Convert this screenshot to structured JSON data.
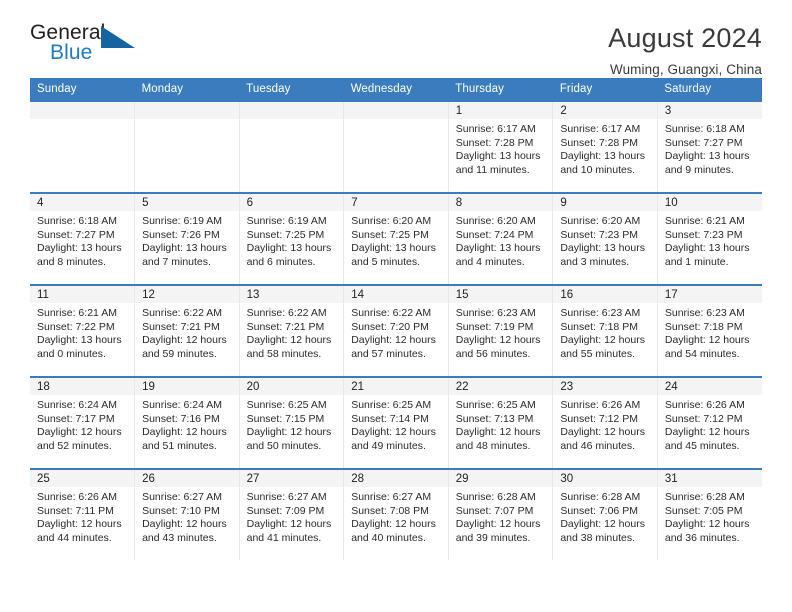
{
  "brand": {
    "word_primary": "General",
    "word_secondary": "Blue",
    "logo_icon": "triangle-logo-icon"
  },
  "header": {
    "title": "August 2024",
    "subtitle": "Wuming, Guangxi, China"
  },
  "colors": {
    "header_blue": "#3a7cbe",
    "brand_blue": "#1f7ac4",
    "logo_blue": "#15639f",
    "daynum_band": "#f4f4f4",
    "text": "#2b2b2b"
  },
  "calendar": {
    "weekday_headers": [
      "Sunday",
      "Monday",
      "Tuesday",
      "Wednesday",
      "Thursday",
      "Friday",
      "Saturday"
    ],
    "weeks": [
      [
        {
          "day": "",
          "sunrise": "",
          "sunset": "",
          "daylight_line1": "",
          "daylight_line2": ""
        },
        {
          "day": "",
          "sunrise": "",
          "sunset": "",
          "daylight_line1": "",
          "daylight_line2": ""
        },
        {
          "day": "",
          "sunrise": "",
          "sunset": "",
          "daylight_line1": "",
          "daylight_line2": ""
        },
        {
          "day": "",
          "sunrise": "",
          "sunset": "",
          "daylight_line1": "",
          "daylight_line2": ""
        },
        {
          "day": "1",
          "sunrise": "Sunrise: 6:17 AM",
          "sunset": "Sunset: 7:28 PM",
          "daylight_line1": "Daylight: 13 hours",
          "daylight_line2": "and 11 minutes."
        },
        {
          "day": "2",
          "sunrise": "Sunrise: 6:17 AM",
          "sunset": "Sunset: 7:28 PM",
          "daylight_line1": "Daylight: 13 hours",
          "daylight_line2": "and 10 minutes."
        },
        {
          "day": "3",
          "sunrise": "Sunrise: 6:18 AM",
          "sunset": "Sunset: 7:27 PM",
          "daylight_line1": "Daylight: 13 hours",
          "daylight_line2": "and 9 minutes."
        }
      ],
      [
        {
          "day": "4",
          "sunrise": "Sunrise: 6:18 AM",
          "sunset": "Sunset: 7:27 PM",
          "daylight_line1": "Daylight: 13 hours",
          "daylight_line2": "and 8 minutes."
        },
        {
          "day": "5",
          "sunrise": "Sunrise: 6:19 AM",
          "sunset": "Sunset: 7:26 PM",
          "daylight_line1": "Daylight: 13 hours",
          "daylight_line2": "and 7 minutes."
        },
        {
          "day": "6",
          "sunrise": "Sunrise: 6:19 AM",
          "sunset": "Sunset: 7:25 PM",
          "daylight_line1": "Daylight: 13 hours",
          "daylight_line2": "and 6 minutes."
        },
        {
          "day": "7",
          "sunrise": "Sunrise: 6:20 AM",
          "sunset": "Sunset: 7:25 PM",
          "daylight_line1": "Daylight: 13 hours",
          "daylight_line2": "and 5 minutes."
        },
        {
          "day": "8",
          "sunrise": "Sunrise: 6:20 AM",
          "sunset": "Sunset: 7:24 PM",
          "daylight_line1": "Daylight: 13 hours",
          "daylight_line2": "and 4 minutes."
        },
        {
          "day": "9",
          "sunrise": "Sunrise: 6:20 AM",
          "sunset": "Sunset: 7:23 PM",
          "daylight_line1": "Daylight: 13 hours",
          "daylight_line2": "and 3 minutes."
        },
        {
          "day": "10",
          "sunrise": "Sunrise: 6:21 AM",
          "sunset": "Sunset: 7:23 PM",
          "daylight_line1": "Daylight: 13 hours",
          "daylight_line2": "and 1 minute."
        }
      ],
      [
        {
          "day": "11",
          "sunrise": "Sunrise: 6:21 AM",
          "sunset": "Sunset: 7:22 PM",
          "daylight_line1": "Daylight: 13 hours",
          "daylight_line2": "and 0 minutes."
        },
        {
          "day": "12",
          "sunrise": "Sunrise: 6:22 AM",
          "sunset": "Sunset: 7:21 PM",
          "daylight_line1": "Daylight: 12 hours",
          "daylight_line2": "and 59 minutes."
        },
        {
          "day": "13",
          "sunrise": "Sunrise: 6:22 AM",
          "sunset": "Sunset: 7:21 PM",
          "daylight_line1": "Daylight: 12 hours",
          "daylight_line2": "and 58 minutes."
        },
        {
          "day": "14",
          "sunrise": "Sunrise: 6:22 AM",
          "sunset": "Sunset: 7:20 PM",
          "daylight_line1": "Daylight: 12 hours",
          "daylight_line2": "and 57 minutes."
        },
        {
          "day": "15",
          "sunrise": "Sunrise: 6:23 AM",
          "sunset": "Sunset: 7:19 PM",
          "daylight_line1": "Daylight: 12 hours",
          "daylight_line2": "and 56 minutes."
        },
        {
          "day": "16",
          "sunrise": "Sunrise: 6:23 AM",
          "sunset": "Sunset: 7:18 PM",
          "daylight_line1": "Daylight: 12 hours",
          "daylight_line2": "and 55 minutes."
        },
        {
          "day": "17",
          "sunrise": "Sunrise: 6:23 AM",
          "sunset": "Sunset: 7:18 PM",
          "daylight_line1": "Daylight: 12 hours",
          "daylight_line2": "and 54 minutes."
        }
      ],
      [
        {
          "day": "18",
          "sunrise": "Sunrise: 6:24 AM",
          "sunset": "Sunset: 7:17 PM",
          "daylight_line1": "Daylight: 12 hours",
          "daylight_line2": "and 52 minutes."
        },
        {
          "day": "19",
          "sunrise": "Sunrise: 6:24 AM",
          "sunset": "Sunset: 7:16 PM",
          "daylight_line1": "Daylight: 12 hours",
          "daylight_line2": "and 51 minutes."
        },
        {
          "day": "20",
          "sunrise": "Sunrise: 6:25 AM",
          "sunset": "Sunset: 7:15 PM",
          "daylight_line1": "Daylight: 12 hours",
          "daylight_line2": "and 50 minutes."
        },
        {
          "day": "21",
          "sunrise": "Sunrise: 6:25 AM",
          "sunset": "Sunset: 7:14 PM",
          "daylight_line1": "Daylight: 12 hours",
          "daylight_line2": "and 49 minutes."
        },
        {
          "day": "22",
          "sunrise": "Sunrise: 6:25 AM",
          "sunset": "Sunset: 7:13 PM",
          "daylight_line1": "Daylight: 12 hours",
          "daylight_line2": "and 48 minutes."
        },
        {
          "day": "23",
          "sunrise": "Sunrise: 6:26 AM",
          "sunset": "Sunset: 7:12 PM",
          "daylight_line1": "Daylight: 12 hours",
          "daylight_line2": "and 46 minutes."
        },
        {
          "day": "24",
          "sunrise": "Sunrise: 6:26 AM",
          "sunset": "Sunset: 7:12 PM",
          "daylight_line1": "Daylight: 12 hours",
          "daylight_line2": "and 45 minutes."
        }
      ],
      [
        {
          "day": "25",
          "sunrise": "Sunrise: 6:26 AM",
          "sunset": "Sunset: 7:11 PM",
          "daylight_line1": "Daylight: 12 hours",
          "daylight_line2": "and 44 minutes."
        },
        {
          "day": "26",
          "sunrise": "Sunrise: 6:27 AM",
          "sunset": "Sunset: 7:10 PM",
          "daylight_line1": "Daylight: 12 hours",
          "daylight_line2": "and 43 minutes."
        },
        {
          "day": "27",
          "sunrise": "Sunrise: 6:27 AM",
          "sunset": "Sunset: 7:09 PM",
          "daylight_line1": "Daylight: 12 hours",
          "daylight_line2": "and 41 minutes."
        },
        {
          "day": "28",
          "sunrise": "Sunrise: 6:27 AM",
          "sunset": "Sunset: 7:08 PM",
          "daylight_line1": "Daylight: 12 hours",
          "daylight_line2": "and 40 minutes."
        },
        {
          "day": "29",
          "sunrise": "Sunrise: 6:28 AM",
          "sunset": "Sunset: 7:07 PM",
          "daylight_line1": "Daylight: 12 hours",
          "daylight_line2": "and 39 minutes."
        },
        {
          "day": "30",
          "sunrise": "Sunrise: 6:28 AM",
          "sunset": "Sunset: 7:06 PM",
          "daylight_line1": "Daylight: 12 hours",
          "daylight_line2": "and 38 minutes."
        },
        {
          "day": "31",
          "sunrise": "Sunrise: 6:28 AM",
          "sunset": "Sunset: 7:05 PM",
          "daylight_line1": "Daylight: 12 hours",
          "daylight_line2": "and 36 minutes."
        }
      ]
    ]
  }
}
